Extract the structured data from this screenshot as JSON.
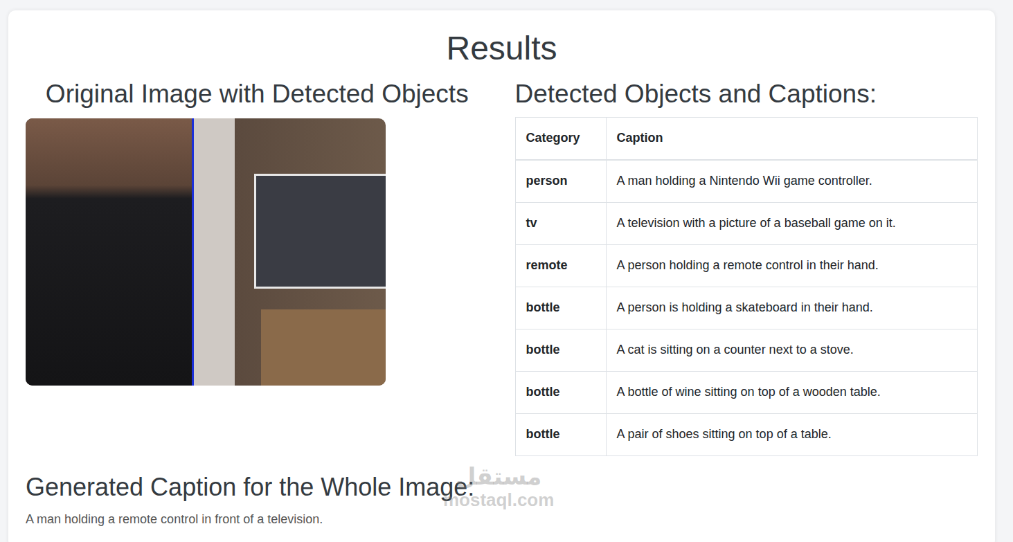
{
  "page": {
    "title": "Results"
  },
  "image_panel": {
    "heading": "Original Image with Detected Objects"
  },
  "table": {
    "heading": "Detected Objects and Captions:",
    "columns": [
      "Category",
      "Caption"
    ],
    "rows": [
      {
        "category": "person",
        "caption": "A man holding a Nintendo Wii game controller."
      },
      {
        "category": "tv",
        "caption": "A television with a picture of a baseball game on it."
      },
      {
        "category": "remote",
        "caption": "A person holding a remote control in their hand."
      },
      {
        "category": "bottle",
        "caption": "A person is holding a skateboard in their hand."
      },
      {
        "category": "bottle",
        "caption": "A cat is sitting on a counter next to a stove."
      },
      {
        "category": "bottle",
        "caption": "A bottle of wine sitting on top of a wooden table."
      },
      {
        "category": "bottle",
        "caption": "A pair of shoes sitting on top of a table."
      }
    ]
  },
  "summary": {
    "heading": "Generated Caption for the Whole Image:",
    "caption": "A man holding a remote control in front of a television."
  },
  "watermark": {
    "arabic": "مستقل",
    "latin": "mostaql.com"
  }
}
